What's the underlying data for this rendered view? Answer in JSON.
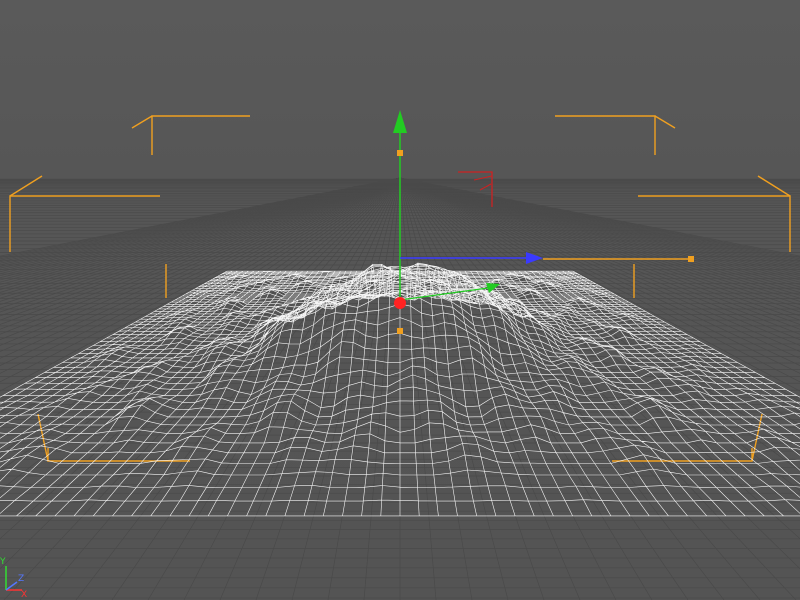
{
  "viewport": {
    "view": "perspective",
    "background": "#555555",
    "grid_color": "#4a4a4a",
    "horizon_grid": true
  },
  "selection": {
    "object": "landscape",
    "display": "wireframe",
    "wire_color": "#ffffff",
    "bracket_color": "#f0a020"
  },
  "gizmo": {
    "x_color": "#3a3aff",
    "y_color": "#22cc22",
    "origin_color": "#ff2222",
    "handle_color": "#f0a020"
  },
  "camera_marker": {
    "color": "#cc2222"
  },
  "world_axes": {
    "colors": {
      "x": "#ff3333",
      "y": "#33dd33",
      "z": "#5577ff"
    },
    "labels": {
      "y": "Y",
      "z": "Z",
      "x": "X"
    }
  }
}
